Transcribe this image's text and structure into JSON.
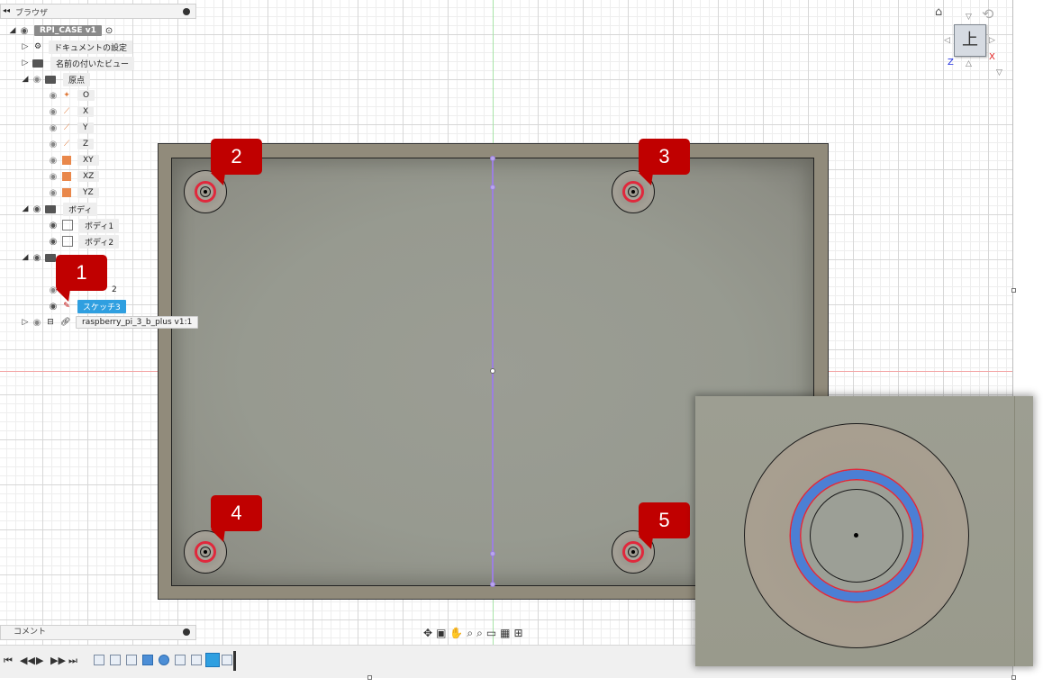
{
  "browser": {
    "title": "ブラウザ",
    "collapse_icon": "double-left-arrow-icon",
    "root_label": "RPI_CASE v1",
    "items": {
      "doc_settings": "ドキュメントの設定",
      "named_views": "名前の付いたビュー",
      "origin": "原点",
      "origin_o": "O",
      "origin_x": "X",
      "origin_y": "Y",
      "origin_z": "Z",
      "origin_xy": "XY",
      "origin_xz": "XZ",
      "origin_yz": "YZ",
      "bodies": "ボディ",
      "body1": "ボディ1",
      "body2": "ボディ2",
      "sketch2_partial": "2",
      "sketch3": "スケッチ3",
      "component": "raspberry_pi_3_b_plus v1:1"
    }
  },
  "comments": {
    "title": "コメント"
  },
  "viewcube": {
    "face_label": "上",
    "axis_x": "X",
    "axis_z": "Z"
  },
  "callouts": [
    "1",
    "2",
    "3",
    "4",
    "5"
  ],
  "colors": {
    "case_wall": "#918b7b",
    "sketch_line": "#9c7fe0",
    "selection_ring": "#e0283c",
    "highlight_blue": "#4c7fd4",
    "selected_item": "#2f9fe0",
    "callout": "#c00000"
  }
}
